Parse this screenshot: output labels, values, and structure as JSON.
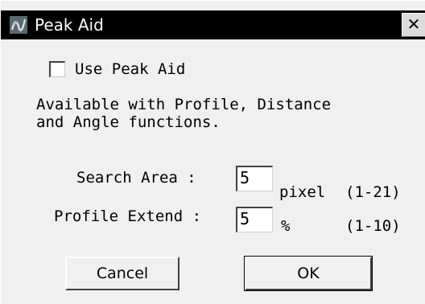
{
  "window": {
    "title": "Peak Aid",
    "close_label": "✕"
  },
  "options": {
    "use_peak_aid_label": "Use Peak Aid",
    "use_peak_aid_checked": false
  },
  "info": {
    "line1": "Available with Profile, Distance",
    "line2": "and Angle functions."
  },
  "search_area": {
    "label": "Search Area :",
    "value": "5",
    "unit": "pixel",
    "range": "(1-21)"
  },
  "profile_extend": {
    "label": "Profile Extend :",
    "value": "5",
    "unit": "%",
    "range": "(1-10)"
  },
  "buttons": {
    "cancel": "Cancel",
    "ok": "OK"
  }
}
